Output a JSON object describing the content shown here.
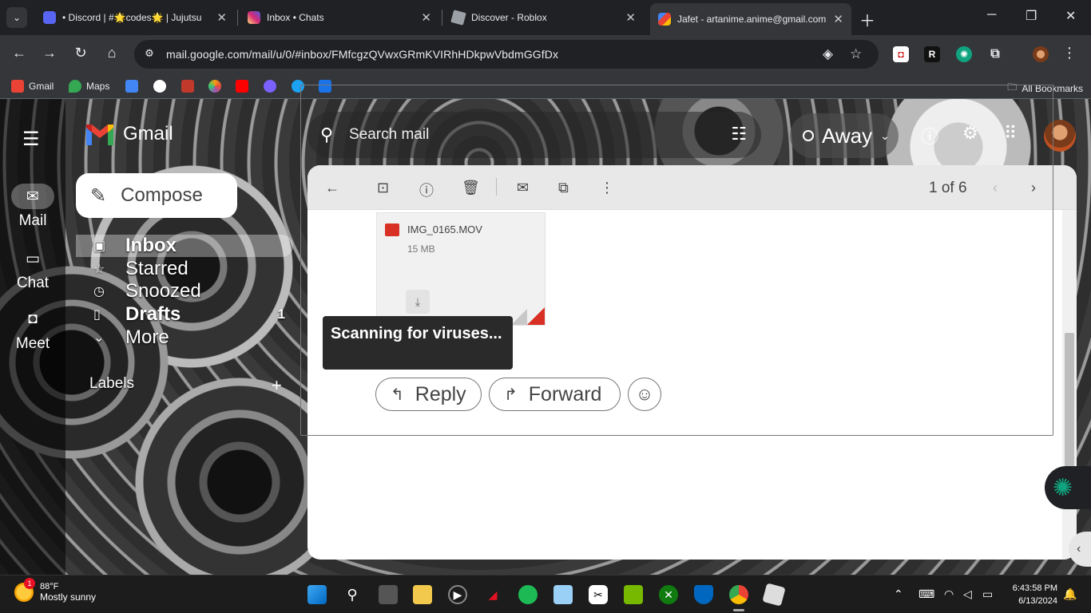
{
  "browser": {
    "tabs": [
      {
        "title": "• Discord | #🌟codes🌟 | Jujutsu",
        "active": false
      },
      {
        "title": "Inbox • Chats",
        "active": false
      },
      {
        "title": "Discover - Roblox",
        "active": false
      },
      {
        "title": "Jafet - artanime.anime@gmail.com",
        "active": true
      }
    ],
    "url": "mail.google.com/mail/u/0/#inbox/FMfcgzQVwxGRmKVIRhHDkpwVbdmGGfDx",
    "bookmarks": [
      {
        "label": "Gmail",
        "color": "#ea4335"
      },
      {
        "label": "Maps",
        "color": "#34a853"
      },
      {
        "label": "",
        "color": "#4285f4"
      },
      {
        "label": "",
        "color": "#ffffff"
      },
      {
        "label": "",
        "color": "#c0392b"
      },
      {
        "label": "",
        "color": "#f39c12"
      },
      {
        "label": "",
        "color": "#ff0000"
      },
      {
        "label": "",
        "color": "#7b61ff"
      },
      {
        "label": "",
        "color": "#1da1f2"
      },
      {
        "label": "",
        "color": "#1a73e8"
      }
    ],
    "all_bookmarks": "All Bookmarks"
  },
  "gmail": {
    "logo_text": "Gmail",
    "compose_label": "Compose",
    "rail": [
      {
        "label": "Mail",
        "icon": "mail-icon"
      },
      {
        "label": "Chat",
        "icon": "chat-icon"
      },
      {
        "label": "Meet",
        "icon": "video-icon"
      }
    ],
    "nav": [
      {
        "label": "Inbox",
        "icon": "inbox-icon",
        "count": "",
        "active": true
      },
      {
        "label": "Starred",
        "icon": "star-icon",
        "count": "",
        "active": false
      },
      {
        "label": "Snoozed",
        "icon": "clock-icon",
        "count": "",
        "active": false
      },
      {
        "label": "Drafts",
        "icon": "draft-icon",
        "count": "1",
        "active": false
      },
      {
        "label": "More",
        "icon": "chevron-down-icon",
        "count": "",
        "active": false
      }
    ],
    "labels_header": "Labels",
    "search_placeholder": "Search mail",
    "status": "Away",
    "pager": "1 of 6",
    "attachment": {
      "filename": "IMG_0165.MOV",
      "size": "15 MB"
    },
    "tooltip": "Scanning for viruses...",
    "reply_label": "Reply",
    "forward_label": "Forward"
  },
  "taskbar": {
    "temperature": "88°F",
    "weather": "Mostly sunny",
    "weather_badge": "1",
    "time": "6:43:58 PM",
    "date": "6/13/2024"
  },
  "colors": {
    "accent_red": "#d93025",
    "chrome_dark": "#202124",
    "chrome_toolbar": "#35363a"
  }
}
